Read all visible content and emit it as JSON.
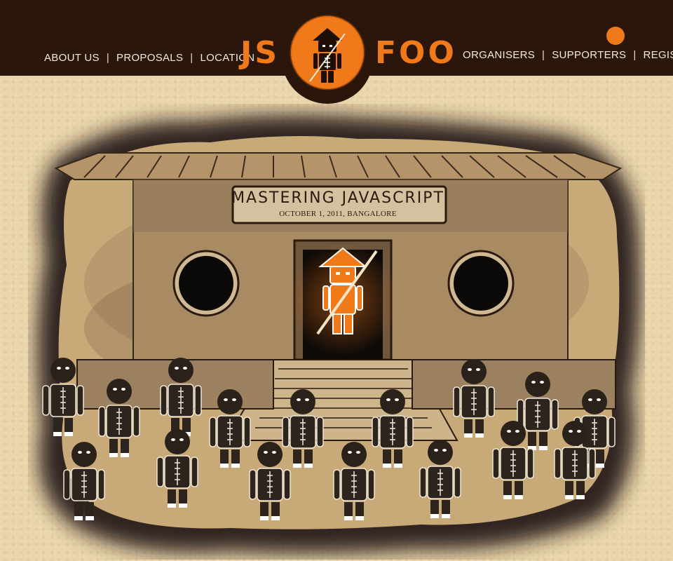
{
  "nav": {
    "left": [
      "ABOUT US",
      "PROPOSALS",
      "LOCATION"
    ],
    "right": [
      "ORGANISERS",
      "SUPPORTERS",
      "REGISTER"
    ],
    "separator": "|"
  },
  "logo": {
    "left": "JS",
    "right": "FOO"
  },
  "hero": {
    "title": "MASTERING JAVASCRIPT",
    "subtitle": "OCTOBER 1, 2011, BANGALORE"
  },
  "colors": {
    "header_bg": "#2a160a",
    "accent_orange": "#f07a1a",
    "page_bg": "#e9d5a9",
    "ink": "#2a1a10"
  },
  "icons": {
    "register": "orange-dot-icon",
    "logo": "ninja-badge-icon",
    "hero_figure": "ninja-master-icon",
    "crowd": "ninja-student-icon"
  }
}
